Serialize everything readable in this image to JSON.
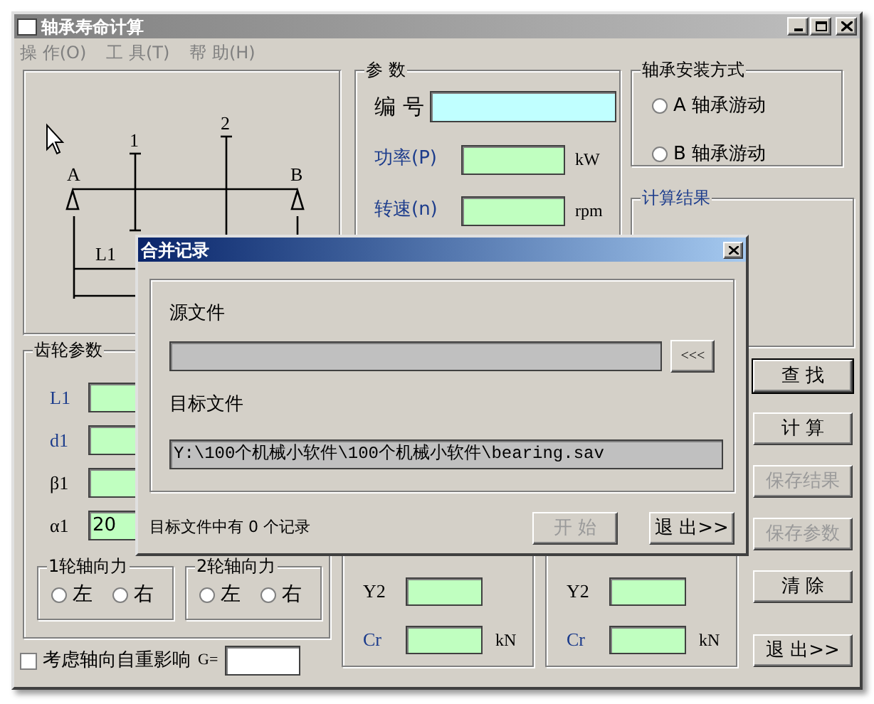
{
  "window": {
    "title": "轴承寿命计算"
  },
  "menu": [
    {
      "label": "操 作(O)"
    },
    {
      "label": "工 具(T)"
    },
    {
      "label": "帮 助(H)"
    }
  ],
  "diagram": {
    "support_a": "A",
    "support_b": "B",
    "gear_1": "1",
    "gear_2": "2",
    "span_label": "L1"
  },
  "params": {
    "title": "参  数",
    "fields": [
      {
        "label": "编 号",
        "kind": "id"
      },
      {
        "label": "功率(P)",
        "kind": "input",
        "unit": "kW"
      },
      {
        "label": "转速(n)",
        "kind": "input",
        "unit": "rpm"
      }
    ]
  },
  "mounting": {
    "title": "轴承安装方式",
    "options": [
      {
        "label": "A 轴承游动",
        "selected": false
      },
      {
        "label": "B 轴承游动",
        "selected": false
      }
    ]
  },
  "results": {
    "title": "计算结果"
  },
  "gear_params": {
    "title": "齿轮参数",
    "fields": [
      {
        "label": "L1",
        "emphasis": true
      },
      {
        "label": "d1",
        "emphasis": true
      },
      {
        "label": "β1",
        "emphasis": false
      },
      {
        "label": "α1",
        "emphasis": false,
        "value": "20"
      }
    ],
    "axial_groups": [
      {
        "title": "1轮轴向力",
        "options": [
          {
            "label": "左",
            "selected": false
          },
          {
            "label": "右",
            "selected": false
          }
        ]
      },
      {
        "title": "2轮轴向力",
        "options": [
          {
            "label": "左",
            "selected": false
          },
          {
            "label": "右",
            "selected": false
          }
        ]
      }
    ]
  },
  "self_weight": {
    "label": "考虑轴向自重影响",
    "checked": false,
    "g_label": "G="
  },
  "lower_groups": [
    {
      "rows": [
        {
          "label": "Y2",
          "emphasis": false
        },
        {
          "label": "Cr",
          "emphasis": true,
          "unit": "kN"
        }
      ]
    },
    {
      "rows": [
        {
          "label": "Y2",
          "emphasis": false
        },
        {
          "label": "Cr",
          "emphasis": true,
          "unit": "kN"
        }
      ]
    }
  ],
  "buttons": [
    {
      "label": "查  找",
      "default": true,
      "disabled": false
    },
    {
      "label": "计  算",
      "default": false,
      "disabled": false
    },
    {
      "label": "保存结果",
      "default": false,
      "disabled": true
    },
    {
      "label": "保存参数",
      "default": false,
      "disabled": true
    },
    {
      "label": "清  除",
      "default": false,
      "disabled": false
    },
    {
      "label": "退 出>>",
      "default": false,
      "disabled": false
    }
  ],
  "dialog": {
    "title": "合并记录",
    "source_label": "源文件",
    "browse_button": "<<<",
    "target_label": "目标文件",
    "target_value": "Y:\\100个机械小软件\\100个机械小软件\\bearing.sav",
    "status": "目标文件中有 0 个记录",
    "buttons": [
      {
        "label": "开 始",
        "disabled": true
      },
      {
        "label": "退 出>>",
        "disabled": false
      }
    ]
  }
}
